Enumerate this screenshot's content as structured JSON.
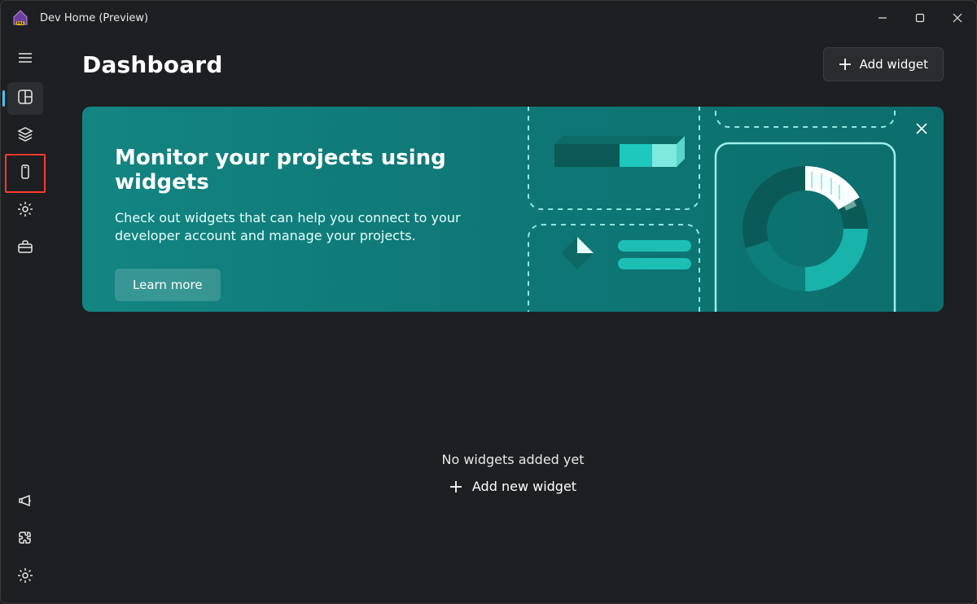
{
  "app": {
    "title": "Dev Home (Preview)"
  },
  "windowControls": {
    "minimize": "Minimize",
    "maximize": "Maximize",
    "close": "Close"
  },
  "sidebar": {
    "hamburger": "Menu",
    "top_items": [
      {
        "icon": "dashboard-icon",
        "name": "sidebar-item-dashboard",
        "aria": "Dashboard",
        "active": true,
        "highlighted": false
      },
      {
        "icon": "layers-icon",
        "name": "sidebar-item-machine-config",
        "aria": "Machine configuration",
        "active": false,
        "highlighted": false
      },
      {
        "icon": "device-icon",
        "name": "sidebar-item-environments",
        "aria": "Environments",
        "active": false,
        "highlighted": true
      },
      {
        "icon": "gear-small-icon",
        "name": "sidebar-item-customization",
        "aria": "Windows customization",
        "active": false,
        "highlighted": false
      },
      {
        "icon": "toolbox-icon",
        "name": "sidebar-item-utilities",
        "aria": "Utilities",
        "active": false,
        "highlighted": false
      }
    ],
    "bottom_items": [
      {
        "icon": "megaphone-icon",
        "name": "sidebar-item-whatsnew",
        "aria": "What's new"
      },
      {
        "icon": "puzzle-icon",
        "name": "sidebar-item-extensions",
        "aria": "Extensions"
      },
      {
        "icon": "gear-icon",
        "name": "sidebar-item-settings",
        "aria": "Settings"
      }
    ]
  },
  "header": {
    "title": "Dashboard",
    "add_widget_label": "Add widget"
  },
  "banner": {
    "title": "Monitor your projects using widgets",
    "description": "Check out widgets that can help you connect to your developer account and manage your projects.",
    "learn_more_label": "Learn more",
    "close_aria": "Dismiss"
  },
  "empty": {
    "heading": "No widgets added yet",
    "add_label": "Add new widget"
  }
}
